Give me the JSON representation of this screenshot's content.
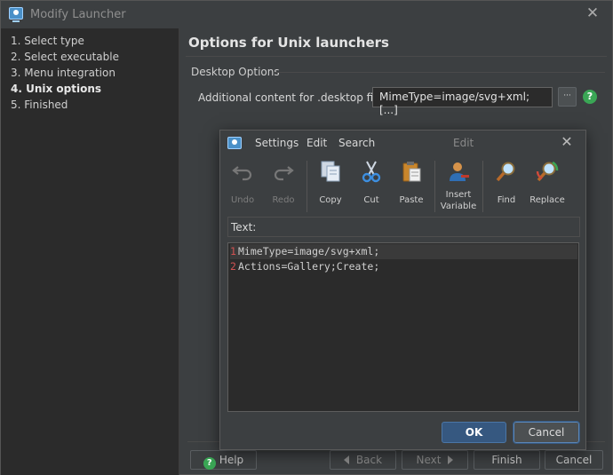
{
  "window": {
    "title": "Modify Launcher",
    "close_glyph": "✕"
  },
  "sidebar": {
    "steps": [
      {
        "label": "1. Select type"
      },
      {
        "label": "2. Select executable"
      },
      {
        "label": "3. Menu integration"
      },
      {
        "label": "4. Unix options"
      },
      {
        "label": "5. Finished"
      }
    ],
    "active_step": 4
  },
  "main": {
    "heading": "Options for Unix launchers",
    "group_label": "Desktop Options",
    "field_label": "Additional content for .desktop file:",
    "field_value": "MimeType=image/svg+xml; [...]",
    "browse_label": "···",
    "help_glyph": "?"
  },
  "footer": {
    "help_label": "Help",
    "back_label": "Back",
    "next_label": "Next",
    "finish_label": "Finish",
    "cancel_label": "Cancel"
  },
  "editor_dialog": {
    "menu": [
      "Settings",
      "Edit",
      "Search"
    ],
    "title": "Edit",
    "close_glyph": "✕",
    "toolbar": [
      {
        "label": "Undo",
        "icon": "undo-icon",
        "enabled": false
      },
      {
        "label": "Redo",
        "icon": "redo-icon",
        "enabled": false
      },
      {
        "label": "Copy",
        "icon": "copy-icon",
        "enabled": true
      },
      {
        "label": "Cut",
        "icon": "scissors-icon",
        "enabled": true
      },
      {
        "label": "Paste",
        "icon": "clipboard-icon",
        "enabled": true
      },
      {
        "label": "Insert Variable",
        "icon": "person-icon",
        "enabled": true
      },
      {
        "label": "Find",
        "icon": "magnifier-icon",
        "enabled": true
      },
      {
        "label": "Replace",
        "icon": "replace-icon",
        "enabled": true
      }
    ],
    "text_label": "Text:",
    "lines": [
      {
        "num": "1",
        "text": "MimeType=image/svg+xml;"
      },
      {
        "num": "2",
        "text": "Actions=Gallery;Create;"
      }
    ],
    "ok_label": "OK",
    "cancel_label": "Cancel"
  },
  "colors": {
    "accent": "#365880",
    "help_green": "#3aa655",
    "line_number": "#d25252"
  }
}
